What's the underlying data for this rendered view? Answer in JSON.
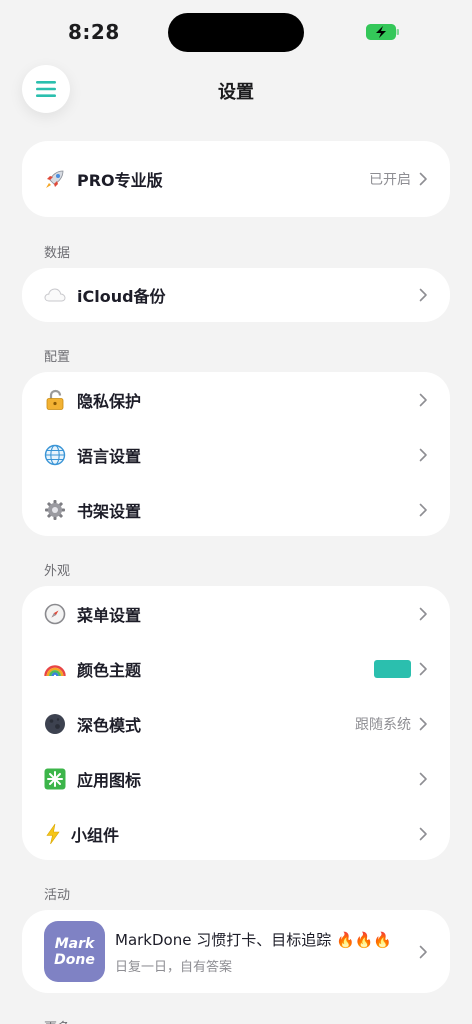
{
  "status_bar": {
    "time": "8:28",
    "battery_color": "#34c759"
  },
  "header": {
    "title": "设置"
  },
  "colors": {
    "accent": "#2bbfae",
    "background": "#f3f3f3",
    "card": "#ffffff"
  },
  "pro": {
    "icon": "rocket-icon",
    "label": "PRO专业版",
    "value": "已开启"
  },
  "sections": {
    "data": {
      "label": "数据",
      "items": [
        {
          "icon": "cloud-icon",
          "label": "iCloud备份"
        }
      ]
    },
    "config": {
      "label": "配置",
      "items": [
        {
          "icon": "lock-icon",
          "label": "隐私保护"
        },
        {
          "icon": "globe-icon",
          "label": "语言设置"
        },
        {
          "icon": "gear-icon",
          "label": "书架设置"
        }
      ]
    },
    "appearance": {
      "label": "外观",
      "items": [
        {
          "icon": "compass-icon",
          "label": "菜单设置"
        },
        {
          "icon": "rainbow-icon",
          "label": "颜色主题",
          "swatch": "#2bbfae"
        },
        {
          "icon": "moon-icon",
          "label": "深色模式",
          "value": "跟随系统"
        },
        {
          "icon": "sparkle-icon",
          "label": "应用图标"
        },
        {
          "icon": "lightning-icon",
          "label": "小组件"
        }
      ]
    },
    "activity": {
      "label": "活动",
      "promo": {
        "logo_line1": "Mark",
        "logo_line2": "Done",
        "title": "MarkDone 习惯打卡、目标追踪 🔥🔥🔥",
        "subtitle": "日复一日，自有答案"
      }
    },
    "more": {
      "label": "更多"
    }
  }
}
